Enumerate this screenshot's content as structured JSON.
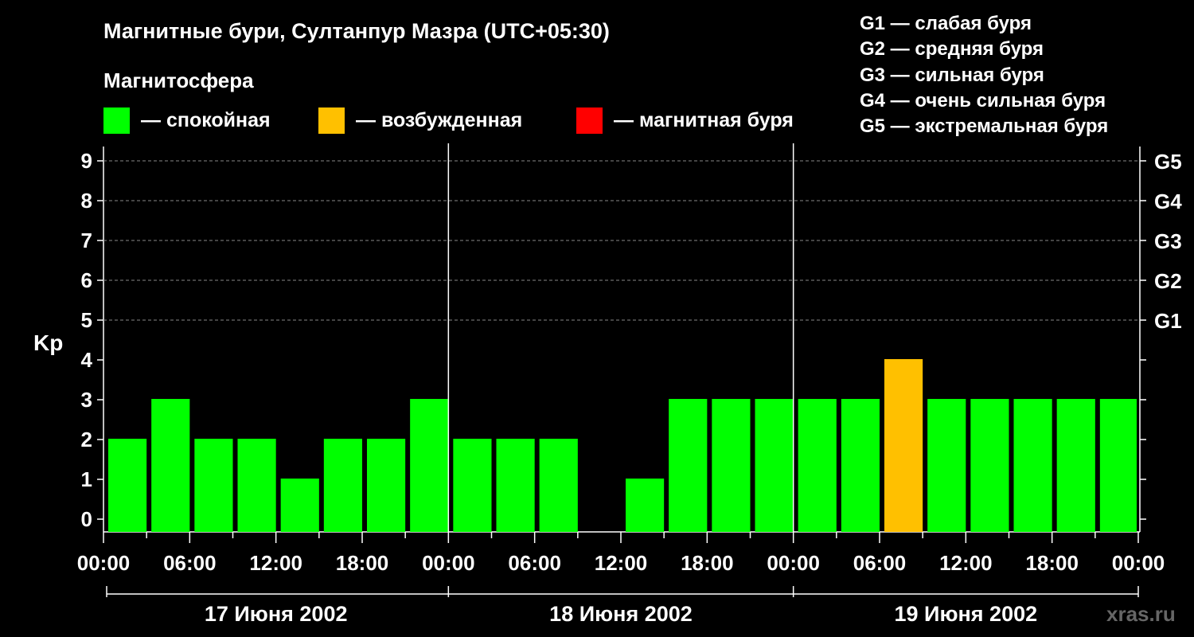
{
  "header": {
    "title": "Магнитные бури, Султанпур Мазра (UTC+05:30)",
    "subtitle": "Магнитосфера"
  },
  "legend": [
    {
      "label": "— спокойная",
      "color": "#00ff00"
    },
    {
      "label": "— возбужденная",
      "color": "#ffc000"
    },
    {
      "label": "— магнитная буря",
      "color": "#ff0000"
    }
  ],
  "g_scale": [
    "G1 — слабая буря",
    "G2 — средняя буря",
    "G3 — сильная буря",
    "G4 — очень сильная буря",
    "G5 — экстремальная буря"
  ],
  "brand": "xras.ru",
  "chart_data": {
    "type": "bar",
    "ylabel": "Kp",
    "ylim": [
      0,
      9
    ],
    "yticks": [
      0,
      1,
      2,
      3,
      4,
      5,
      6,
      7,
      8,
      9
    ],
    "right_axis_labels": [
      {
        "kp": 5,
        "label": "G1"
      },
      {
        "kp": 6,
        "label": "G2"
      },
      {
        "kp": 7,
        "label": "G3"
      },
      {
        "kp": 8,
        "label": "G4"
      },
      {
        "kp": 9,
        "label": "G5"
      }
    ],
    "x_tick_labels": [
      "00:00",
      "06:00",
      "12:00",
      "18:00",
      "00:00",
      "06:00",
      "12:00",
      "18:00",
      "00:00",
      "06:00",
      "12:00",
      "18:00",
      "00:00"
    ],
    "days": [
      "17 Июня 2002",
      "18 Июня 2002",
      "19 Июня 2002"
    ],
    "interval_hours": 3,
    "values": [
      2,
      3,
      2,
      2,
      1,
      2,
      2,
      3,
      2,
      2,
      2,
      0,
      1,
      3,
      3,
      3,
      3,
      3,
      4,
      3,
      3,
      3,
      3,
      3
    ],
    "colors": [
      "#00ff00",
      "#00ff00",
      "#00ff00",
      "#00ff00",
      "#00ff00",
      "#00ff00",
      "#00ff00",
      "#00ff00",
      "#00ff00",
      "#00ff00",
      "#00ff00",
      "#00ff00",
      "#00ff00",
      "#00ff00",
      "#00ff00",
      "#00ff00",
      "#00ff00",
      "#00ff00",
      "#ffc000",
      "#00ff00",
      "#00ff00",
      "#00ff00",
      "#00ff00",
      "#00ff00"
    ],
    "grid": true
  }
}
